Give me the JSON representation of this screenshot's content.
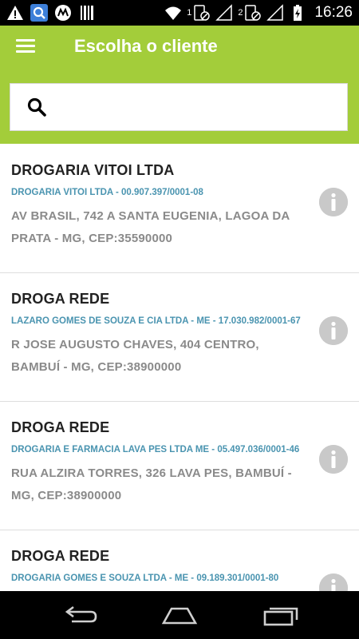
{
  "status_bar": {
    "time": "16:26",
    "sim1": "1",
    "sim2": "2",
    "icons": [
      "warning-icon",
      "search-app-icon",
      "motorola-icon",
      "barcode-icon",
      "wifi-icon",
      "sim1-signal-icon",
      "sim2-signal-icon",
      "battery-charging-icon"
    ]
  },
  "app_bar": {
    "title": "Escolha o cliente",
    "menu_icon": "hamburger-menu-icon"
  },
  "search": {
    "value": "",
    "placeholder": "",
    "icon": "search-icon"
  },
  "clients": [
    {
      "name": "DROGARIA VITOI LTDA",
      "legal": "DROGARIA VITOI LTDA - 00.907.397/0001-08",
      "address": "AV BRASIL, 742 A SANTA EUGENIA, LAGOA DA PRATA - MG, CEP:35590000"
    },
    {
      "name": "DROGA REDE",
      "legal": "LAZARO GOMES DE SOUZA E CIA LTDA - ME - 17.030.982/0001-67",
      "address": "R JOSE AUGUSTO CHAVES, 404 CENTRO, BAMBUÍ - MG, CEP:38900000"
    },
    {
      "name": "DROGA REDE",
      "legal": "DROGARIA E FARMACIA LAVA PES LTDA ME - 05.497.036/0001-46",
      "address": "RUA ALZIRA TORRES, 326 LAVA PES, BAMBUÍ - MG, CEP:38900000"
    },
    {
      "name": "DROGA REDE",
      "legal": "DROGARIA GOMES E SOUZA LTDA - ME - 09.189.301/0001-80",
      "address": ""
    }
  ],
  "colors": {
    "accent": "#a3cd3a",
    "legal_text": "#4a94b0",
    "address_text": "#8a8a8a",
    "info_icon_bg": "#c9c9c9"
  },
  "nav_bar": {
    "icons": [
      "back-icon",
      "home-icon",
      "recent-apps-icon"
    ]
  }
}
